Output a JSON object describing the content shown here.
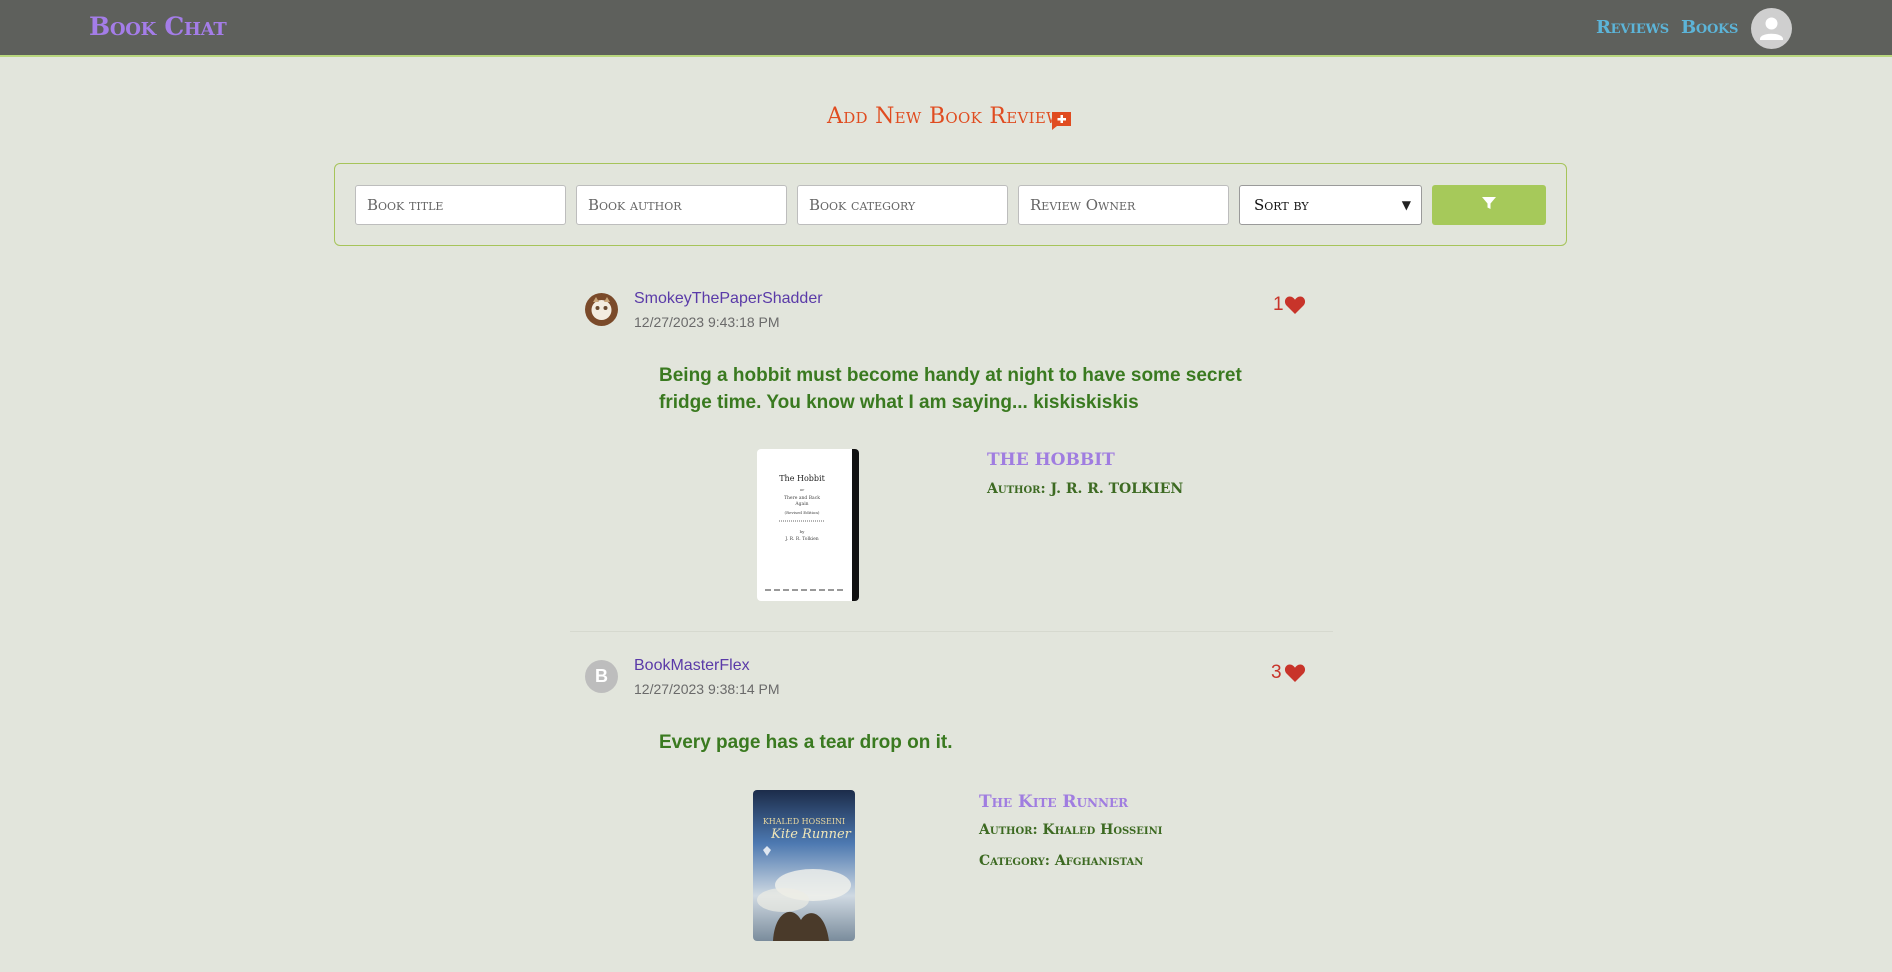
{
  "nav": {
    "brand": "Book Chat",
    "links": [
      "Reviews",
      "Books"
    ],
    "profile_icon": "user-avatar-icon"
  },
  "add_review": {
    "label": "Add New Book Review",
    "icon": "add-comment-icon"
  },
  "filters": {
    "title_placeholder": "Book title",
    "author_placeholder": "Book author",
    "category_placeholder": "Book category",
    "owner_placeholder": "Review Owner",
    "sort_label": "Sort by",
    "filter_icon": "filter-icon"
  },
  "reviews": [
    {
      "username": "SmokeyThePaperShadder",
      "timestamp": "12/27/2023 9:43:18 PM",
      "likes": "1",
      "text_lines": [
        "Being a hobbit must become handy at night to have some secret",
        "fridge time. You know what I am saying... kiskiskiskis"
      ],
      "book_title": "THE HOBBIT",
      "book_author": "Author: J. R. R. TOLKIEN",
      "book_category": ""
    },
    {
      "username": "BookMasterFlex",
      "avatar_letter": "B",
      "timestamp": "12/27/2023 9:38:14 PM",
      "likes": "3",
      "text_lines": [
        "Every page has a tear drop on it."
      ],
      "book_title": "The Kite Runner",
      "book_author": "Author: Khaled Hosseini",
      "book_category": "Category: Afghanistan"
    }
  ],
  "colors": {
    "background": "#e2e5dc",
    "navbar": "#5e605c",
    "brand": "#a47de8",
    "nav_link": "#5cb4d8",
    "accent_orange": "#e04c20",
    "filter_button": "#a6c95a",
    "review_text": "#3a7a20",
    "likes": "#c8342a"
  }
}
